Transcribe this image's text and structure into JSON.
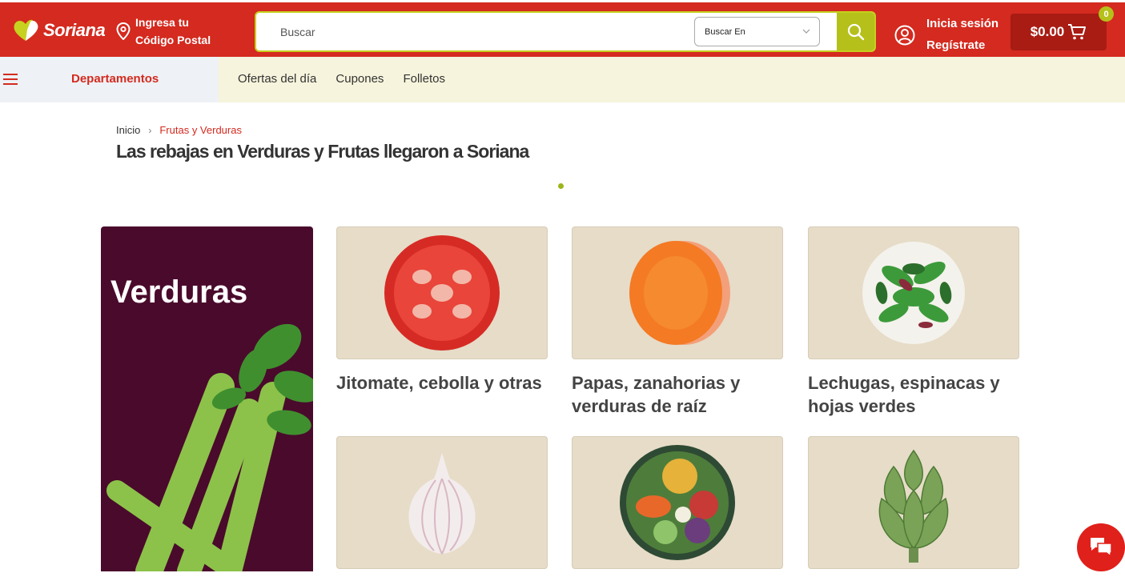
{
  "header": {
    "logo_text": "Soriana",
    "postal_line1": "Ingresa tu",
    "postal_line2": "Código Postal",
    "search_placeholder": "Buscar",
    "search_scope": "Buscar En",
    "login_label": "Inicia sesión",
    "register_label": "Regístrate",
    "cart_total": "$0.00",
    "cart_count": "0"
  },
  "nav": {
    "departments_label": "Departamentos",
    "links": [
      "Ofertas del día",
      "Cupones",
      "Folletos"
    ]
  },
  "breadcrumb": {
    "home": "Inicio",
    "separator": "›",
    "current": "Frutas y Verduras"
  },
  "page_title": "Las rebajas en Verduras y Frutas llegaron a Soriana",
  "banner": {
    "title": "Verduras"
  },
  "categories": [
    {
      "label": "Jitomate, cebolla y otras",
      "icon": "tomato-image"
    },
    {
      "label": "Papas, zanahorias y verduras de raíz",
      "icon": "carrot-slice-image"
    },
    {
      "label": "Lechugas, espinacas y hojas verdes",
      "icon": "salad-greens-image"
    },
    {
      "label": "",
      "icon": "garlic-image"
    },
    {
      "label": "",
      "icon": "salad-bowl-image"
    },
    {
      "label": "",
      "icon": "artichoke-image"
    }
  ],
  "colors": {
    "brand_red": "#d42a1f",
    "accent_lime": "#b5c01a",
    "banner_purple": "#4a0a2c",
    "card_beige": "#e6dcc8"
  }
}
